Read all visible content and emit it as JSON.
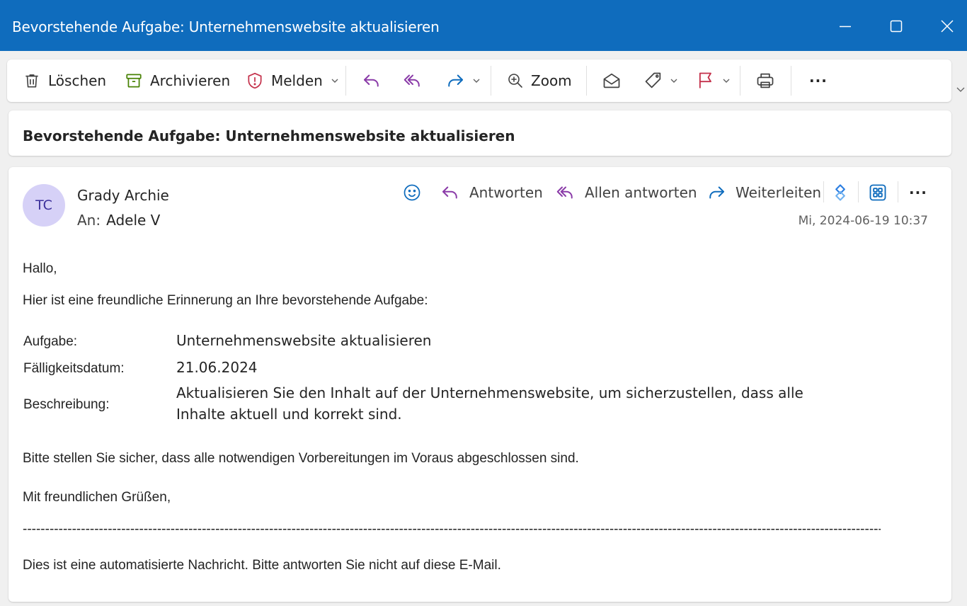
{
  "window": {
    "title": "Bevorstehende Aufgabe: Unternehmenswebsite aktualisieren",
    "controls": [
      "minimize-icon",
      "maximize-icon",
      "close-icon"
    ]
  },
  "toolbar": {
    "delete_label": "Löschen",
    "archive_label": "Archivieren",
    "report_label": "Melden",
    "zoom_label": "Zoom",
    "more_label": "···",
    "icons": [
      "delete-icon",
      "archive-icon",
      "shield-icon",
      "reply-icon",
      "reply-all-icon",
      "forward-icon",
      "zoom-icon",
      "envelope-open-icon",
      "tag-icon",
      "flag-icon",
      "print-icon",
      "more-icon"
    ]
  },
  "subject": "Bevorstehende Aufgabe: Unternehmenswebsite aktualisieren",
  "message": {
    "avatar_initials": "TC",
    "sender": "Grady Archie",
    "to_label": "An:",
    "to_name": "Adele V",
    "actions": {
      "reply": "Antworten",
      "reply_all": "Allen antworten",
      "forward": "Weiterleiten",
      "more": "···"
    },
    "date": "Mi, 2024-06-19 10:37",
    "greeting": "Hallo,",
    "intro": "Hier ist eine freundliche Erinnerung an Ihre bevorstehende Aufgabe:",
    "details": [
      {
        "label": "Aufgabe:",
        "value": "Unternehmenswebsite aktualisieren"
      },
      {
        "label": "Fälligkeitsdatum:",
        "value": "21.06.2024"
      },
      {
        "label": "Beschreibung:",
        "value": "Aktualisieren Sie den Inhalt auf der Unternehmenswebsite, um sicherzustellen, dass alle Inhalte aktuell und korrekt sind."
      }
    ],
    "reminder": "Bitte stellen Sie sicher, dass alle notwendigen Vorbereitungen im Voraus abgeschlossen sind.",
    "closing": "Mit freundlichen Grüßen,",
    "separator": "--------------------------------------------------------------------------------------------------------------------------------------------------------------------------------------------------------------------------------------------------------------------------------",
    "footer": "Dies ist eine automatisierte Nachricht. Bitte antworten Sie nicht auf diese E-Mail."
  },
  "colors": {
    "titlebar": "#0f6cbd",
    "accent_purple": "#8a3ba8",
    "accent_blue": "#0f6cbd",
    "report_red": "#c4314b",
    "archive_green": "#498205",
    "avatar_bg": "#d6d1f7"
  }
}
